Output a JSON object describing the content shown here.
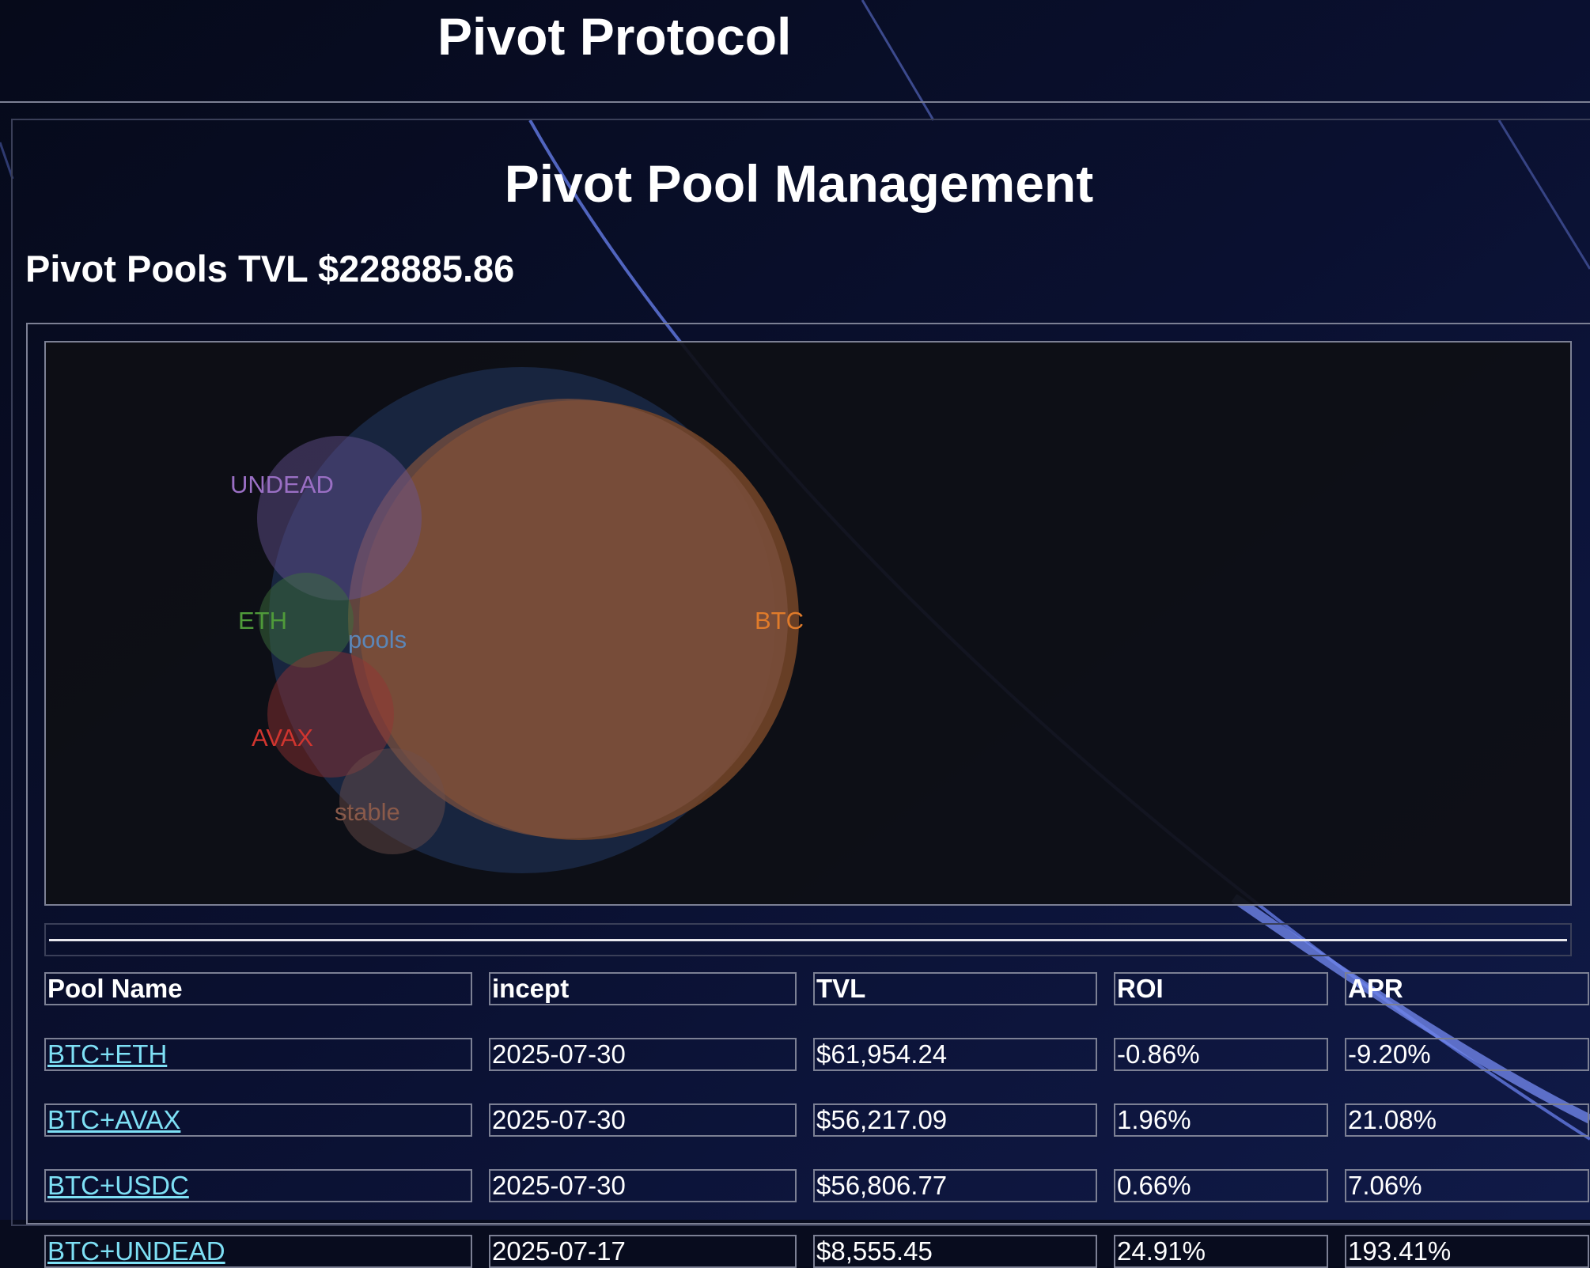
{
  "header": {
    "title": "Pivot Protocol"
  },
  "page": {
    "title": "Pivot Pool Management",
    "tvl_label": "Pivot Pools TVL",
    "tvl_value": "$228885.86"
  },
  "chart_data": {
    "type": "bubble",
    "root_label": "pools",
    "nodes": [
      {
        "name": "BTC",
        "color": "#e07b2a"
      },
      {
        "name": "UNDEAD",
        "color": "#9a6fc4"
      },
      {
        "name": "ETH",
        "color": "#4f9a3a"
      },
      {
        "name": "AVAX",
        "color": "#d0352f"
      },
      {
        "name": "stable",
        "color": "#8a5a4a"
      }
    ],
    "root_color": "#3a7ac4"
  },
  "table": {
    "columns": [
      "Pool Name",
      "incept",
      "TVL",
      "ROI",
      "APR"
    ],
    "rows": [
      {
        "name": "BTC+ETH",
        "incept": "2025-07-30",
        "tvl": "$61,954.24",
        "roi": "-0.86%",
        "apr": "-9.20%"
      },
      {
        "name": "BTC+AVAX",
        "incept": "2025-07-30",
        "tvl": "$56,217.09",
        "roi": "1.96%",
        "apr": "21.08%"
      },
      {
        "name": "BTC+USDC",
        "incept": "2025-07-30",
        "tvl": "$56,806.77",
        "roi": "0.66%",
        "apr": "7.06%"
      },
      {
        "name": "BTC+UNDEAD",
        "incept": "2025-07-17",
        "tvl": "$8,555.45",
        "roi": "24.91%",
        "apr": "193.41%"
      }
    ]
  }
}
